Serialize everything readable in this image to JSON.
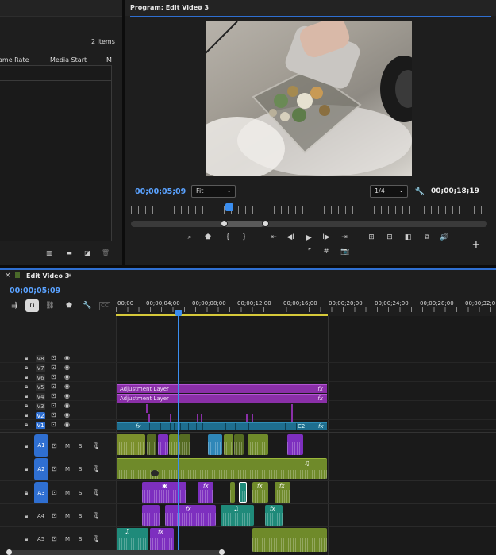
{
  "project": {
    "items_count": "2 items",
    "columns": [
      "ame Rate",
      "Media Start",
      "M"
    ]
  },
  "program": {
    "title": "Program: Edit Video 3",
    "menu_icon": "hamburger-icon",
    "timecode_current": "00;00;05;09",
    "fit": "Fit",
    "resolution": "1/4",
    "timecode_duration": "00;00;18;19"
  },
  "timeline": {
    "title": "Edit Video 3",
    "timecode": "00;00;05;09",
    "ruler": [
      "00;00",
      "00;00;04;00",
      "00;00;08;00",
      "00;00;12;00",
      "00;00;16;00",
      "00;00;20;00",
      "00;00;24;00",
      "00;00;28;00",
      "00;00;32;0"
    ],
    "video_tracks": [
      "V8",
      "V7",
      "V6",
      "V5",
      "V4",
      "V3",
      "V2",
      "V1"
    ],
    "audio_tracks": [
      "A1",
      "A2",
      "A3",
      "A4",
      "A5"
    ],
    "adjustment_label_1": "Adjustment Layer",
    "adjustment_label_2": "Adjustment Layer",
    "fx": "fx",
    "clip_c2": "C2",
    "m_label": "M",
    "s_label": "S",
    "cc_label": "CC"
  },
  "colors": {
    "accent_blue": "#2f6fd1",
    "timecode_blue": "#5aa2ff",
    "adjustment_purple": "#8a2fa8",
    "video_clip": "#1e6e8f",
    "audio_green": "#6f8a2a",
    "audio_purple": "#7d2fbf",
    "audio_teal": "#1f8a7a"
  }
}
